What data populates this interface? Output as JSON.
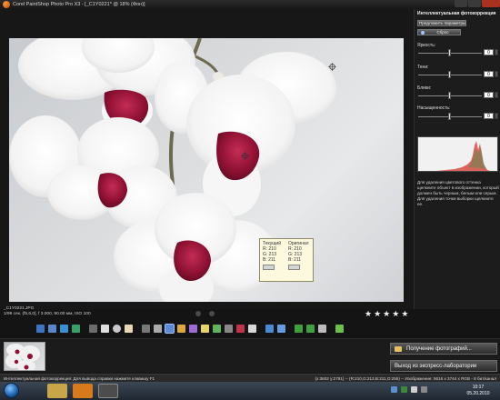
{
  "window": {
    "title": "Corel PaintShop Photo Pro X3 - [_C1Y0221* @ 18% (Фон)]"
  },
  "viewer": {
    "file_name": "_C1Y0221.JPG",
    "exif": "1/99 сек. (f5,6,0], f 3.000, 90.00 мм, ISO 100",
    "rating_stars": [
      "★",
      "★",
      "★",
      "★",
      "★"
    ],
    "rating": 5
  },
  "pixel_info": {
    "current_label": "Текущий",
    "original_label": "Оригинал",
    "current": {
      "r": "R: 210",
      "g": "G: 213",
      "b": "B: 211"
    },
    "original": {
      "r": "R: 210",
      "g": "G: 213",
      "b": "B: 211"
    }
  },
  "panel": {
    "title": "Интеллектуальная фотокоррекция",
    "suggest_button": "Предложить параметры",
    "reset_button": "Сброс",
    "sliders": [
      {
        "label": "Яркость:",
        "value": "0",
        "position": 0.5
      },
      {
        "label": "Тени:",
        "value": "0",
        "position": 0.5
      },
      {
        "label": "Блики:",
        "value": "0",
        "position": 0.5
      },
      {
        "label": "Насыщенность:",
        "value": "0",
        "position": 0.5
      }
    ],
    "help_text": "Для удаления цветового оттенка щелкните объект в изображении, который должен быть черным, белым или серым. Для удаления точки выборки щелкните ее."
  },
  "actions": {
    "get_photos": "Получение фотографий...",
    "exit_express": "Выход из экспресс-лаборатории"
  },
  "status": {
    "left": "Интеллектуальная фотокоррекция: Для вывода справки нажмите клавишу F1",
    "right": "(x:3602 y:2791) -- (R:210,G:213,B:211,O:255) -- Изображение: 5616 x 3744 x RGB - 8 бит/канал"
  },
  "taskbar": {
    "time": "10:17",
    "date": "05.20.2010"
  },
  "colors": {
    "accent": "#c8102e",
    "petal": "#f8f7f7",
    "throat": "#9e1a3a"
  },
  "toolbar_icons": [
    "rotate-left-icon",
    "rotate-right-icon",
    "zoom-icon",
    "pan-icon",
    "crop-icon",
    "smart-fix-icon",
    "red-eye-icon",
    "retouch-icon",
    "delete-icon"
  ]
}
